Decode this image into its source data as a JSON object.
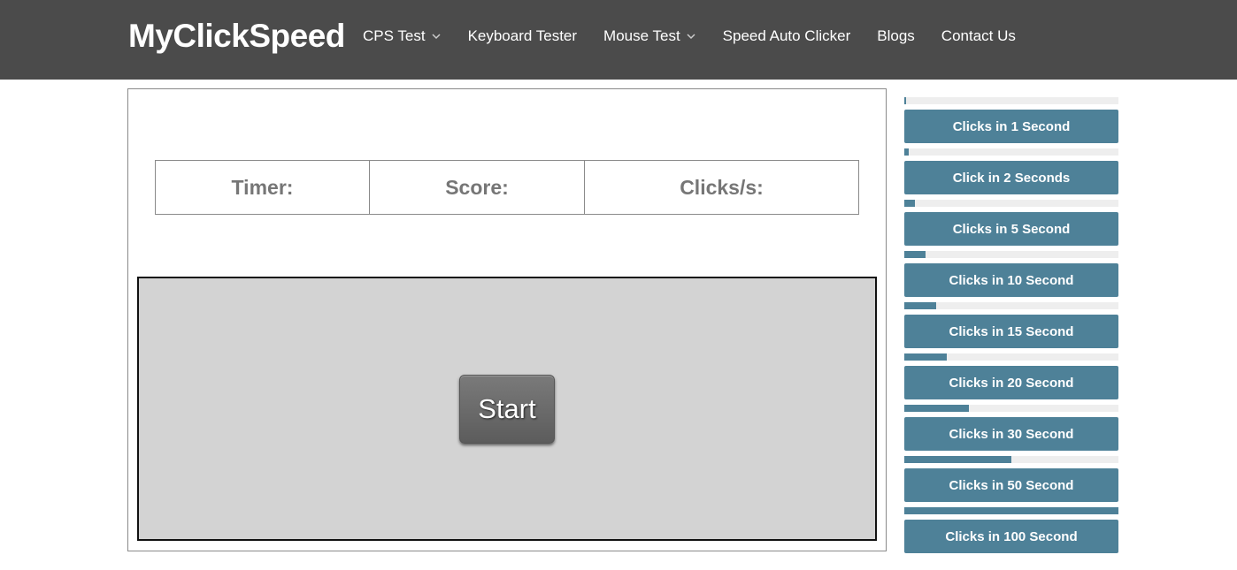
{
  "brand": {
    "name": "MyClickSpeed"
  },
  "nav": {
    "items": [
      {
        "label": "CPS Test",
        "has_dropdown": true
      },
      {
        "label": "Keyboard Tester",
        "has_dropdown": false
      },
      {
        "label": "Mouse Test",
        "has_dropdown": true
      },
      {
        "label": "Speed Auto Clicker",
        "has_dropdown": false
      },
      {
        "label": "Blogs",
        "has_dropdown": false
      },
      {
        "label": "Contact Us",
        "has_dropdown": false
      }
    ]
  },
  "stats": {
    "timer_label": "Timer:",
    "score_label": "Score:",
    "cps_label": "Clicks/s:"
  },
  "click_area": {
    "start_label": "Start"
  },
  "sidebar": {
    "items": [
      {
        "label": "Clicks in 1 Second",
        "level": 0.01
      },
      {
        "label": "Click in 2 Seconds",
        "level": 0.02
      },
      {
        "label": "Clicks in 5 Second",
        "level": 0.05
      },
      {
        "label": "Clicks in 10 Second",
        "level": 0.1
      },
      {
        "label": "Clicks in 15 Second",
        "level": 0.15
      },
      {
        "label": "Clicks in 20 Second",
        "level": 0.2
      },
      {
        "label": "Clicks in 30 Second",
        "level": 0.3
      },
      {
        "label": "Clicks in 50 Second",
        "level": 0.5
      },
      {
        "label": "Clicks in 100 Second",
        "level": 1.0
      }
    ]
  },
  "colors": {
    "navbar_bg": "#4b4b4b",
    "accent": "#4e8198",
    "click_area_bg": "#d3d3d3",
    "stat_text": "#767676"
  }
}
